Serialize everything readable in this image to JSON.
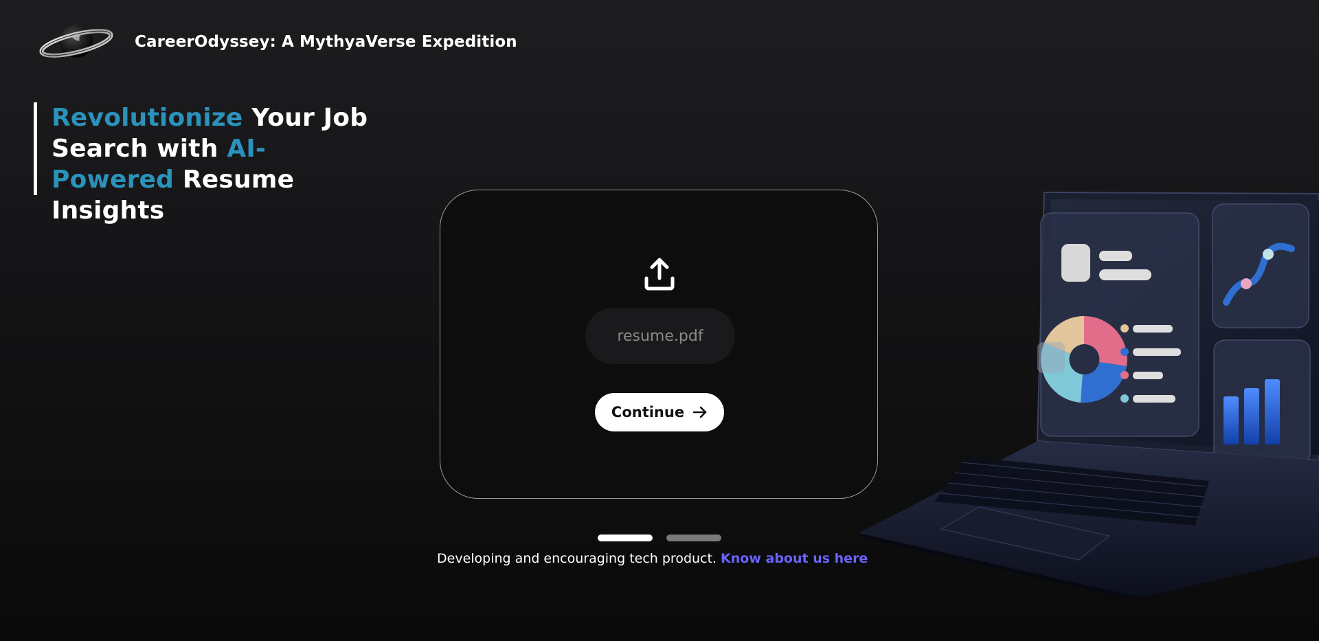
{
  "header": {
    "logo_icon": "saturn-planet-logo-icon",
    "brand": "CareerOdyssey: A MythyaVerse Expedition"
  },
  "hero": {
    "part1": "Revolutionize",
    "part2": " Your Job Search with ",
    "part3": "AI-Powered",
    "part4": " Resume Insights",
    "accent_color": "#2b93bb"
  },
  "upload": {
    "icon": "upload-icon",
    "file_name": "resume.pdf",
    "continue_label": "Continue",
    "continue_icon": "arrow-right-icon"
  },
  "carousel": {
    "active_index": 0,
    "total": 2
  },
  "footer": {
    "text": "Developing and encouraging tech product. ",
    "link": "Know about us here",
    "link_color": "#6b63ff"
  },
  "illustration": {
    "icon": "laptop-dashboard-illustration-icon"
  }
}
